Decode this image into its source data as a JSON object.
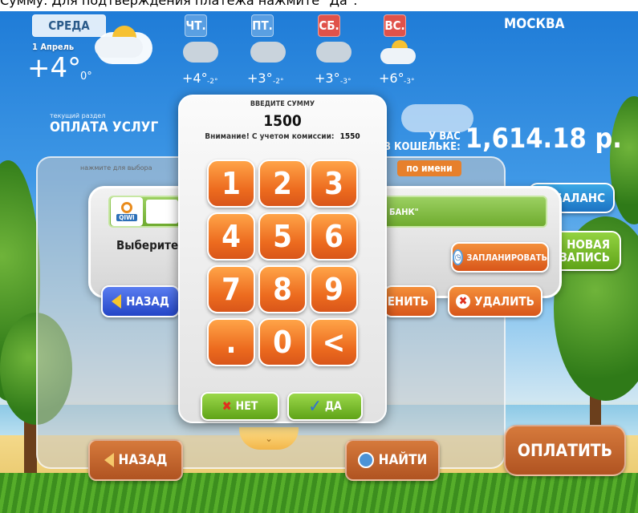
{
  "caption": "Сумму. Для подтверждения платежа нажмите \"Да\".",
  "weather": {
    "city": "МОСКВА",
    "today": {
      "day": "СРЕДА",
      "date": "1 Апрель",
      "temp": "+4°",
      "temp_low": "0°"
    },
    "forecast": [
      {
        "day": "ЧТ.",
        "temp": "+4°",
        "low": "-2°",
        "weekend": false
      },
      {
        "day": "ПТ.",
        "temp": "+3°",
        "low": "-2°",
        "weekend": false
      },
      {
        "day": "СБ.",
        "temp": "+3°",
        "low": "-3°",
        "weekend": true
      },
      {
        "day": "ВС.",
        "temp": "+6°",
        "low": "-3°",
        "weekend": true
      }
    ]
  },
  "section": {
    "small": "текущий раздел",
    "title": "ОПЛАТА УСЛУГ"
  },
  "wallet": {
    "label_line1": "У ВАС",
    "label_line2": "В КОШЕЛЬКЕ:",
    "amount": "1,614.18 р."
  },
  "background_panel": {
    "hint": "нажмите для выбора",
    "by_name": "по имени"
  },
  "dialog": {
    "bank_text": "БАНК\"",
    "choose_text": "Выберите до",
    "qiwi": "QIWI",
    "back_label": "НАЗАД",
    "schedule_label": "ЗАПЛАНИРОВАТЬ",
    "change_label": "МЕНИТЬ",
    "delete_label": "УДАЛИТЬ"
  },
  "keypad": {
    "title": "ВВЕДИТЕ СУММУ",
    "amount": "1500",
    "note_label": "Внимание! С учетом комиссии:",
    "note_value": "1550",
    "keys": [
      "1",
      "2",
      "3",
      "4",
      "5",
      "6",
      "7",
      "8",
      "9",
      ".",
      "0",
      "<"
    ],
    "no_label": "НЕТ",
    "yes_label": "ДА"
  },
  "right_buttons": {
    "balance": "БАЛАНС",
    "new_record_1": "НОВАЯ",
    "new_record_2": "ЗАПИСЬ"
  },
  "bottom": {
    "back_label": "НАЗАД",
    "find_label": "НАЙТИ",
    "pay_label": "ОПЛАТИТЬ"
  },
  "colors": {
    "keypad_key": "#ec6a1e",
    "action_green": "#5fa318",
    "back_blue": "#2446c7",
    "sky": "#1d7ad6"
  }
}
